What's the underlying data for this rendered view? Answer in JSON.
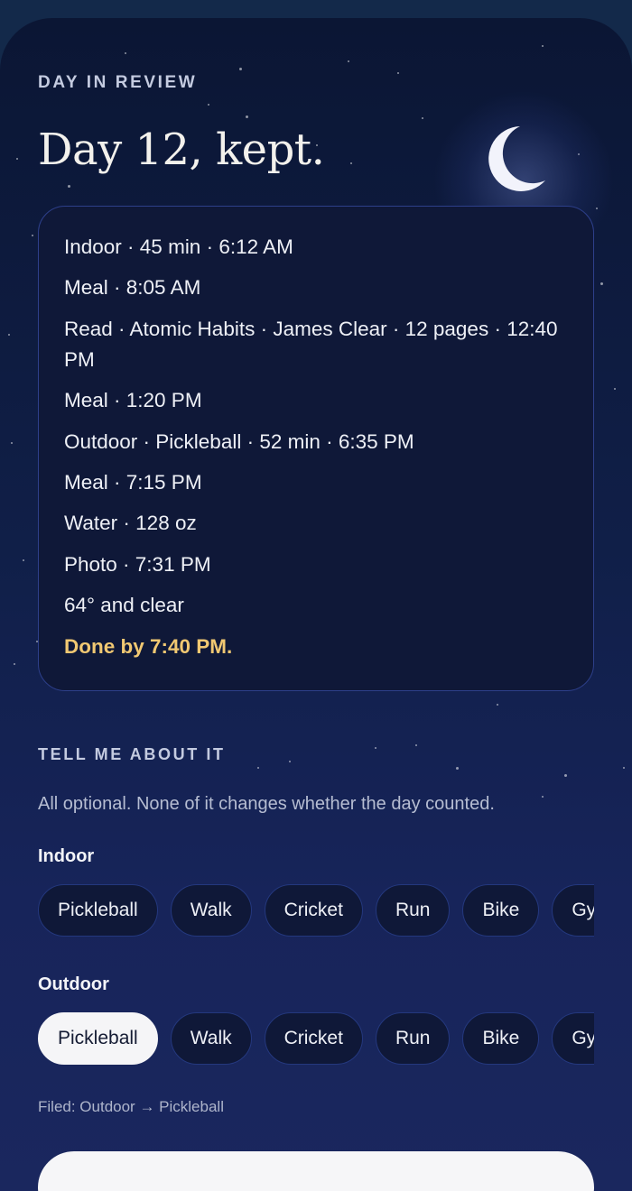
{
  "header": {
    "eyebrow": "DAY IN REVIEW",
    "title": "Day 12, kept."
  },
  "icons": {
    "moon": "moon-icon"
  },
  "log": {
    "lines": [
      "Indoor · 45 min · 6:12 AM",
      "Meal · 8:05 AM",
      "Read · Atomic Habits · James Clear · 12 pages · 12:40 PM",
      "Meal · 1:20 PM",
      "Outdoor · Pickleball · 52 min · 6:35 PM",
      "Meal · 7:15 PM",
      "Water · 128 oz",
      "Photo · 7:31 PM",
      "64° and clear"
    ],
    "done": "Done by 7:40 PM."
  },
  "reflection": {
    "section_label": "TELL ME ABOUT IT",
    "helper": "All optional. None of it changes whether the day counted.",
    "groups": [
      {
        "label": "Indoor",
        "chips": [
          "Pickleball",
          "Walk",
          "Cricket",
          "Run",
          "Bike",
          "Gym"
        ],
        "selected": null
      },
      {
        "label": "Outdoor",
        "chips": [
          "Pickleball",
          "Walk",
          "Cricket",
          "Run",
          "Bike",
          "Gym"
        ],
        "selected": "Pickleball"
      }
    ],
    "filed": "Filed: Outdoor → Pickleball"
  },
  "colors": {
    "accent_done": "#f1c872",
    "card_border": "#2d3f8a",
    "chip_selected_bg": "#f5f5f7"
  }
}
